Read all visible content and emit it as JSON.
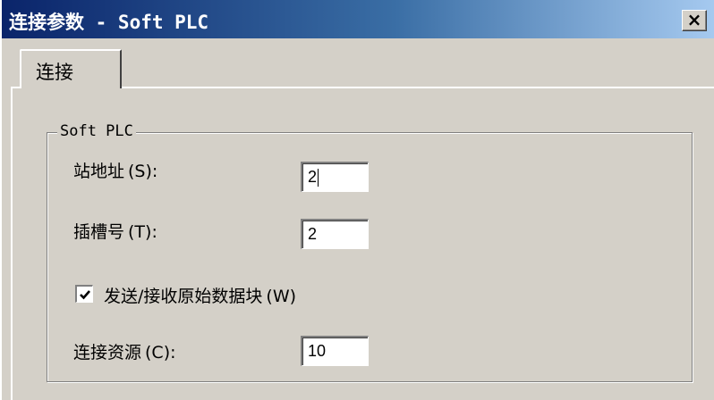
{
  "window": {
    "title": "连接参数 - Soft PLC",
    "close_label": "×"
  },
  "tabs": [
    {
      "label": "连接",
      "selected": true
    }
  ],
  "group": {
    "legend": "Soft PLC",
    "station_address": {
      "label": "站地址",
      "mnemonic": "(S)",
      "suffix": ":",
      "value": "2"
    },
    "slot_number": {
      "label": "插槽号",
      "mnemonic": "(T)",
      "suffix": ":",
      "value": "2"
    },
    "raw_data_block": {
      "label": "发送/接收原始数据块",
      "mnemonic": "(W)",
      "checked": true
    },
    "connection_resource": {
      "label": "连接资源",
      "mnemonic": "(C)",
      "suffix": ":",
      "value": "10"
    }
  },
  "colors": {
    "title_gradient_start": "#0a246a",
    "title_gradient_end": "#a6caf0",
    "face": "#d4d0c8"
  },
  "icons": {
    "close": "close-icon",
    "check": "checkmark-icon"
  }
}
